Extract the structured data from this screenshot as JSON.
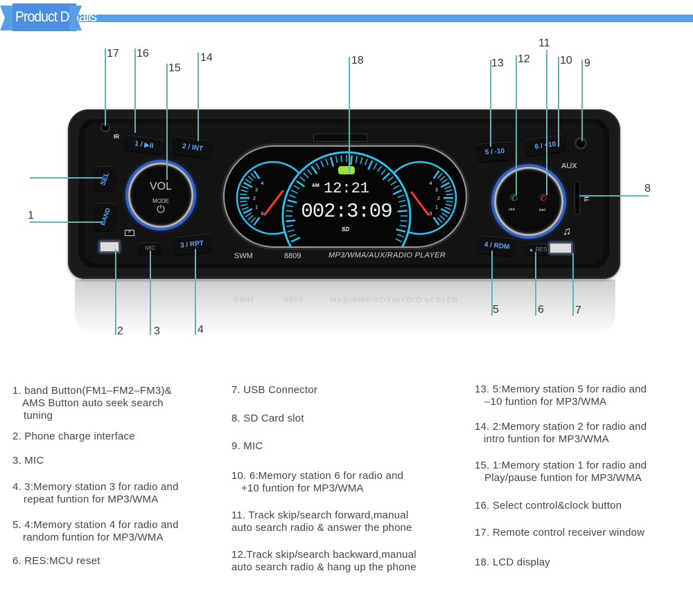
{
  "header": {
    "title": "Product Details",
    "accent_color": "#5b9de6"
  },
  "device": {
    "brand": "SWM",
    "model": "8809",
    "tagline": "MP3/WMA/AUX/RADIO PLAYER",
    "buttons": {
      "b1": "1 / ▶II",
      "b2": "2 / INT",
      "b3": "3 / RPT",
      "b4": "4 / RDM",
      "b5": "5 / -10",
      "b6": "6 / +10",
      "sel": "SEL",
      "band": "BAND",
      "res": "RES",
      "mic": "MIC"
    },
    "knob_left": {
      "label": "VOL",
      "sub": "MODE",
      "icon": "power-icon"
    },
    "knob_right": {
      "prev_icon": "prev-track-icon",
      "next_icon": "next-track-icon",
      "answer_icon": "phone-answer-icon",
      "hangup_icon": "phone-hangup-icon"
    },
    "aux_label": "AUX",
    "tf_label": "TF",
    "ir_label": "IR",
    "display": {
      "ampm": "AM",
      "clock": "12:21",
      "counter": "002:3:09",
      "sd_label": "SD",
      "left_gauge_ticks": [
        "0",
        "1",
        "2",
        "3",
        "4"
      ],
      "right_gauge_ticks": [
        "0",
        "1",
        "2",
        "3",
        "4"
      ]
    },
    "lcd_color": "#29c3f0",
    "button_text_color": "#5aa8ff"
  },
  "callouts": [
    "1",
    "2",
    "3",
    "4",
    "5",
    "6",
    "7",
    "8",
    "9",
    "10",
    "11",
    "12",
    "13",
    "14",
    "15",
    "16",
    "17",
    "18"
  ],
  "legend": {
    "col1": [
      {
        "line1": "1. band Button(FM1–FM2–FM3)&",
        "line2": "AMS Button auto seek search",
        "line3": "tuning"
      },
      {
        "line1": "2. Phone charge interface"
      },
      {
        "line1": "3. MIC"
      },
      {
        "line1": "4. 3:Memory station 3 for radio and",
        "line2": "repeat funtion for MP3/WMA"
      },
      {
        "line1": "5. 4:Memory station 4 for radio and",
        "line2": "random funtion for MP3/WMA"
      },
      {
        "line1": "6. RES:MCU reset"
      }
    ],
    "col2": [
      {
        "line1": "7. USB Connector"
      },
      {
        "line1": "8. SD Card slot"
      },
      {
        "line1": "9. MIC"
      },
      {
        "line1": "10. 6:Memory station 6 for radio and",
        "line2": "+10 funtion for MP3/WMA"
      },
      {
        "line1": "11. Track skip/search forward,manual",
        "line2": "auto search radio & answer the phone"
      },
      {
        "line1": "12.Track skip/search backward,manual",
        "line2": "auto search radio & hang up the phone"
      }
    ],
    "col3": [
      {
        "line1": "13. 5:Memory station 5 for radio and",
        "line2": "–10 funtion for MP3/WMA"
      },
      {
        "line1": "14. 2:Memory station 2 for radio and",
        "line2": "intro funtion for MP3/WMA"
      },
      {
        "line1": "15. 1:Memory station 1 for radio and",
        "line2": "Play/pause funtion for MP3/WMA"
      },
      {
        "line1": "16. Select control&clock button"
      },
      {
        "line1": "17. Remote control receiver window"
      },
      {
        "line1": "18. LCD display"
      }
    ]
  }
}
